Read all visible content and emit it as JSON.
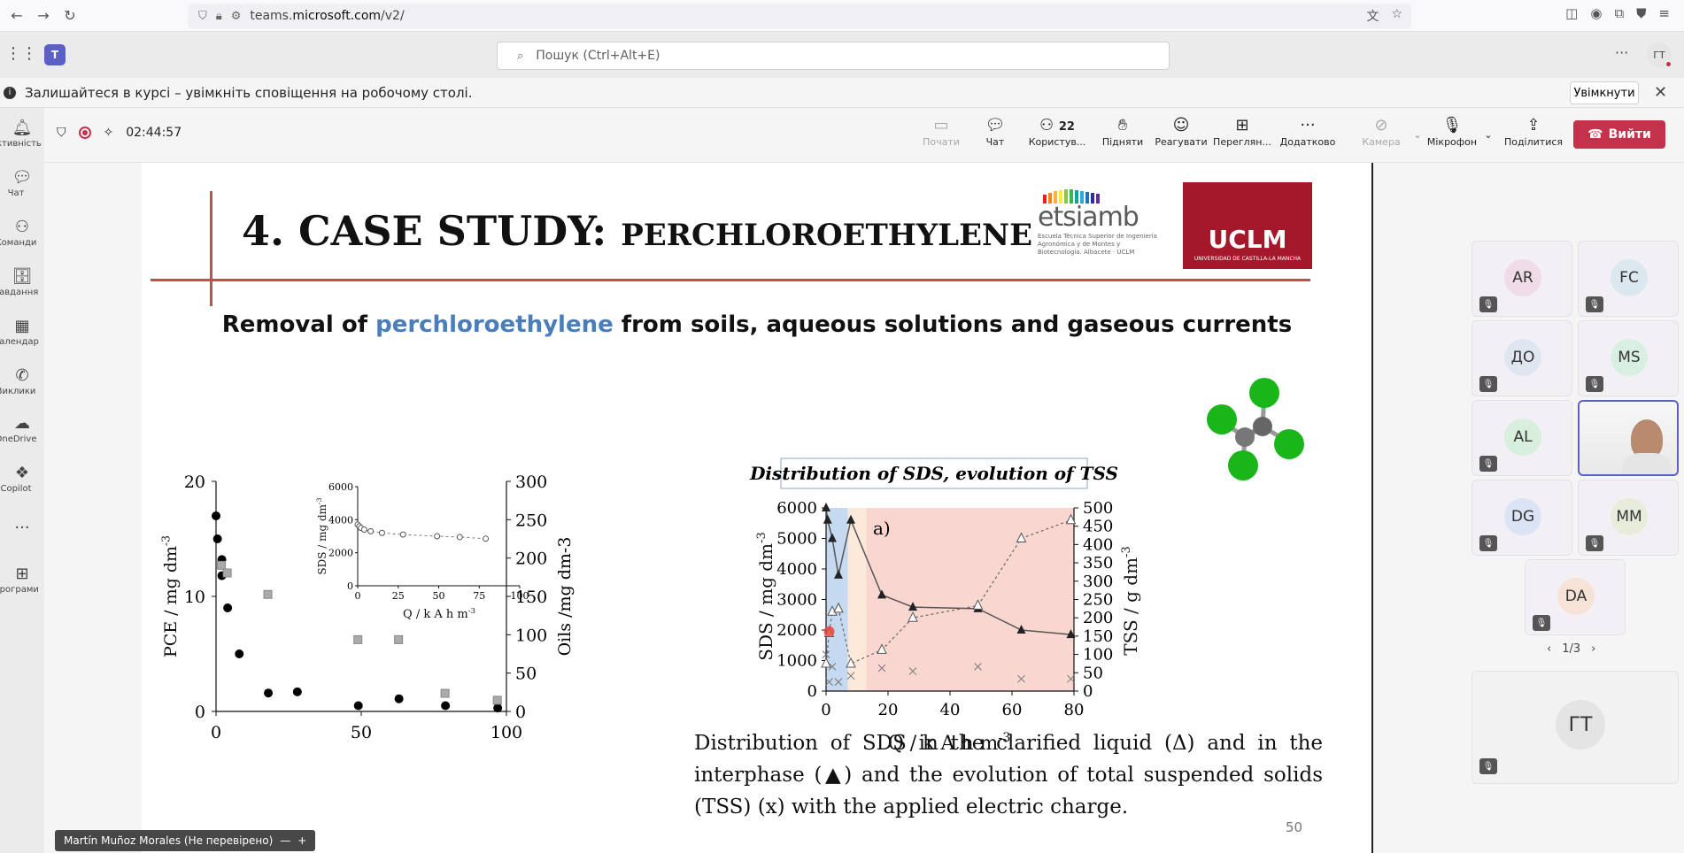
{
  "browser": {
    "url_prefix": "teams.",
    "url_host": "microsoft.com",
    "url_path": "/v2/"
  },
  "teams": {
    "search_placeholder": "Пошук (Ctrl+Alt+E)",
    "avatar_initials": "ГТ"
  },
  "notification": {
    "text": "Залишайтеся в курсі – увімкніть сповіщення на робочому столі.",
    "button": "Увімкнути"
  },
  "rail": {
    "items": [
      {
        "label": "Активність"
      },
      {
        "label": "Чат"
      },
      {
        "label": "Команди"
      },
      {
        "label": "Завдання"
      },
      {
        "label": "Календар"
      },
      {
        "label": "Виклики"
      },
      {
        "label": "OneDrive"
      },
      {
        "label": "Copilot"
      },
      {
        "label": "Програми"
      }
    ]
  },
  "meeting": {
    "timer": "02:44:57",
    "buttons": {
      "start": "Почати",
      "chat": "Чат",
      "people": "Користув...",
      "people_count": "22",
      "raise": "Підняти",
      "react": "Реагувати",
      "view": "Переглян...",
      "more": "Додатково",
      "camera": "Камера",
      "mic": "Мікрофон",
      "share": "Поділитися",
      "leave": "Вийти"
    }
  },
  "slide": {
    "title_main": "4. CASE STUDY: ",
    "title_small": "PERCHLOROETHYLENE",
    "etsiamb_name": "etsiamb",
    "etsiamb_sub": "Escuela Técnica Superior de Ingeniería Agronómica y de Montes y Biotecnología. Albacete · UCLM",
    "uclm_name": "UCLM",
    "uclm_sub": "UNIVERSIDAD DE CASTILLA-LA MANCHA",
    "subtitle_pre": "Removal of ",
    "subtitle_hl": "perchloroethylene",
    "subtitle_post": " from soils, aqueous solutions and gaseous currents",
    "right_chart_title": "Distribution of SDS, evolution of TSS",
    "caption": "Distribution of SDS in the clarified liquid (Δ) and in the interphase (▲) and the evolution of total suspended solids (TSS) (x) with the applied electric charge.",
    "page_number": "50"
  },
  "chart_data": [
    {
      "type": "scatter",
      "xlabel": "Q / k A h m-3",
      "ylabel": "PCE / mg dm-3",
      "y2label": "Oils /mg dm-3",
      "xlim": [
        0,
        100
      ],
      "ylim": [
        0,
        20
      ],
      "y2lim": [
        0,
        300
      ],
      "x_ticks": [
        "0",
        "50",
        "100"
      ],
      "y_ticks": [
        "0",
        "10",
        "20"
      ],
      "y2_ticks": [
        "0",
        "50",
        "100",
        "150",
        "200",
        "250",
        "300"
      ],
      "series": [
        {
          "marker": "circle-filled",
          "color": "#000000",
          "points": [
            [
              0,
              17
            ],
            [
              0.5,
              15
            ],
            [
              2,
              13.2
            ],
            [
              2,
              11.8
            ],
            [
              4,
              9
            ],
            [
              8,
              5
            ],
            [
              18,
              1.6
            ],
            [
              28,
              1.7
            ],
            [
              49,
              0.5
            ],
            [
              63,
              1.1
            ],
            [
              79,
              0.5
            ],
            [
              97,
              0.3
            ]
          ]
        },
        {
          "marker": "square-gray",
          "color": "#aaaaaa",
          "points": [
            [
              2,
              190
            ],
            [
              4,
              180
            ],
            [
              18,
              152
            ],
            [
              49,
              93
            ],
            [
              63,
              93
            ],
            [
              79,
              23
            ],
            [
              97,
              14
            ]
          ]
        }
      ],
      "inset": {
        "xlabel": "Q / k A h m-3",
        "ylabel": "SDS / mg dm-3",
        "xlim": [
          0,
          100
        ],
        "ylim": [
          0,
          6000
        ],
        "x_ticks": [
          "0",
          "25",
          "50",
          "75",
          "100"
        ],
        "y_ticks": [
          "0",
          "2000",
          "4000",
          "6000"
        ],
        "points": [
          [
            0,
            3700
          ],
          [
            1,
            3600
          ],
          [
            2,
            3500
          ],
          [
            4,
            3400
          ],
          [
            8,
            3300
          ],
          [
            15,
            3200
          ],
          [
            28,
            3100
          ],
          [
            49,
            3000
          ],
          [
            63,
            2950
          ],
          [
            79,
            2850
          ]
        ]
      }
    },
    {
      "type": "line",
      "label": "a)",
      "xlabel": "Q / k A h m-3",
      "ylabel": "SDS / mg dm-3",
      "y2label": "TSS / g dm-3",
      "xlim": [
        0,
        80
      ],
      "ylim": [
        0,
        6000
      ],
      "y2lim": [
        0,
        500
      ],
      "x_ticks": [
        "0",
        "20",
        "40",
        "60",
        "80"
      ],
      "y_ticks": [
        "0",
        "1000",
        "2000",
        "3000",
        "4000",
        "5000",
        "6000"
      ],
      "y2_ticks": [
        "0",
        "50",
        "100",
        "150",
        "200",
        "250",
        "300",
        "350",
        "400",
        "450",
        "500"
      ],
      "series": [
        {
          "marker": "triangle-filled",
          "points": [
            [
              0,
              6000
            ],
            [
              0.5,
              5600
            ],
            [
              2,
              5000
            ],
            [
              4,
              3800
            ],
            [
              8,
              5600
            ],
            [
              18,
              3150
            ],
            [
              28,
              2750
            ],
            [
              49,
              2700
            ],
            [
              63,
              2000
            ],
            [
              79,
              1850
            ]
          ]
        },
        {
          "marker": "triangle-open",
          "points": [
            [
              0,
              900
            ],
            [
              1,
              1900
            ],
            [
              2,
              2600
            ],
            [
              4,
              2700
            ],
            [
              8,
              900
            ],
            [
              18,
              1350
            ],
            [
              28,
              2400
            ],
            [
              49,
              2800
            ],
            [
              63,
              5000
            ],
            [
              79,
              5600
            ]
          ]
        },
        {
          "marker": "x",
          "points": [
            [
              0,
              1200
            ],
            [
              1,
              300
            ],
            [
              2,
              800
            ],
            [
              4,
              300
            ],
            [
              8,
              500
            ],
            [
              18,
              750
            ],
            [
              28,
              650
            ],
            [
              49,
              800
            ],
            [
              63,
              400
            ],
            [
              79,
              400
            ]
          ]
        }
      ],
      "regions": [
        {
          "from": 0,
          "to": 7,
          "color": "#c5d9f1"
        },
        {
          "from": 7,
          "to": 13,
          "color": "#fde9d9"
        },
        {
          "from": 13,
          "to": 80,
          "color": "#f9d7d0"
        }
      ]
    }
  ],
  "participants": [
    {
      "initials": "AR",
      "color": "#f0dce6"
    },
    {
      "initials": "FC",
      "color": "#dbe8ef"
    },
    {
      "initials": "ДО",
      "color": "#e0e6f0"
    },
    {
      "initials": "MS",
      "color": "#d9efe2"
    },
    {
      "initials": "AL",
      "color": "#d8efde"
    },
    {
      "initials": "DG",
      "color": "#dbe4f4"
    },
    {
      "initials": "MM",
      "color": "#e8ecdb"
    },
    {
      "initials": "DA",
      "color": "#f6e2d6"
    },
    {
      "initials": "ГТ",
      "color": "#e4e4e4"
    }
  ],
  "pager": "1/3",
  "name_tag": "Martín Muñoz Morales (Не перевірено)",
  "colors": {
    "accent": "#5b5fc7",
    "leave": "#c4314b",
    "title_rule": "#c0504d",
    "uclm": "#a5182c",
    "highlight_text": "#4a7ebb"
  }
}
